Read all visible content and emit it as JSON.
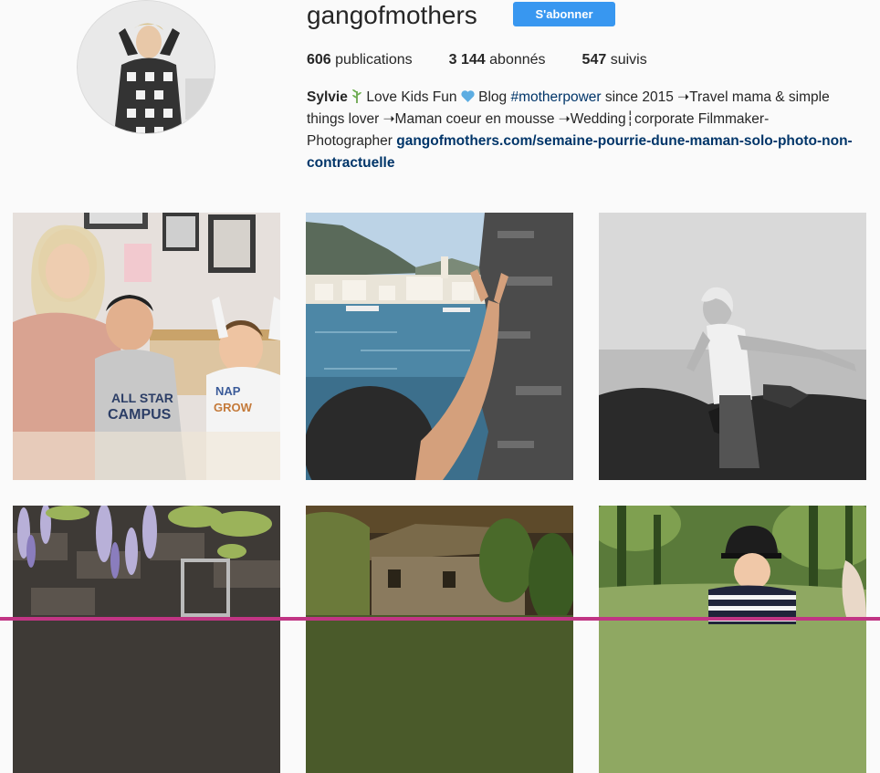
{
  "profile": {
    "username": "gangofmothers",
    "follow_label": "S'abonner",
    "stats": [
      {
        "count": "606",
        "label": " publications"
      },
      {
        "count": "3 144",
        "label": " abonnés"
      },
      {
        "count": "547",
        "label": " suivis"
      }
    ],
    "bio": {
      "name": "Sylvie",
      "text1": " Love Kids Fun ",
      "text2": " Blog ",
      "hashtag": "#motherpower",
      "text3": " since 2015 ➝Travel mama & simple things lover ➝Maman coeur en mousse ➝Wedding┆corporate Filmmaker-Photographer ",
      "link": "gangofmothers.com/semaine-pourrie-dune-maman-solo-photo-non-contractuelle"
    }
  },
  "posts": [
    {
      "icon": "family-photo"
    },
    {
      "icon": "sea-photo"
    },
    {
      "icon": "bw-woman-photo"
    },
    {
      "icon": "wisteria-photo"
    },
    {
      "icon": "cottage-photo"
    },
    {
      "icon": "child-helmet-photo"
    }
  ],
  "colors": {
    "accent": "#3897f0",
    "link": "#003569",
    "background": "#fafafa"
  }
}
